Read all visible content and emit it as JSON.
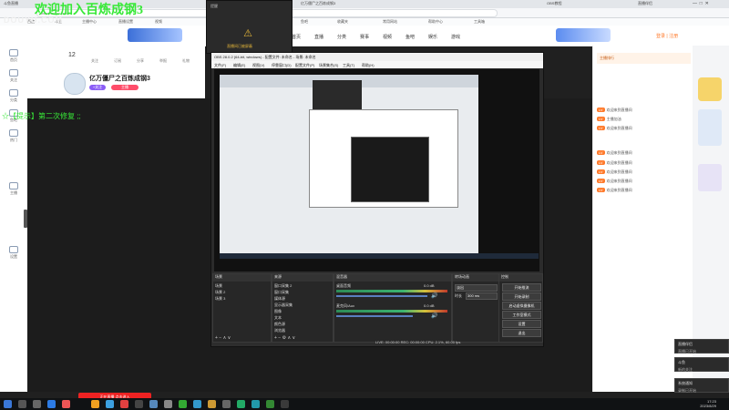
{
  "browser": {
    "tabs": [
      "斗鱼直播",
      "亿万僵尸之百炼成钢3",
      "OBS教程",
      "直播伴侣"
    ],
    "address": "www.douyu.com/...",
    "bookmarks": [
      "百度",
      "斗鱼",
      "主播中心",
      "直播设置",
      "视频",
      "鱼吧",
      "收藏夹",
      "常用网站",
      "帮助中心",
      "工具箱"
    ]
  },
  "watermark": "DOUYU.COM",
  "overlay_title": "欢迎加入百炼成钢3",
  "overlay_sub": "☆【提示】第二次修复 ;;",
  "site": {
    "nav": [
      "首页",
      "直播",
      "分类",
      "赛事",
      "视频",
      "鱼吧",
      "娱乐",
      "游戏"
    ],
    "login": "登录 | 注册"
  },
  "sidebar": [
    "首页",
    "关注",
    "分类",
    "鱼吧",
    "热门",
    "主播",
    "设置"
  ],
  "room": {
    "count": "12",
    "stats": [
      "关注",
      "订阅",
      "分享",
      "举报",
      "礼物"
    ],
    "title": "亿万僵尸之百炼成钢3",
    "follow": "+关注",
    "tag": "主播"
  },
  "chat": {
    "header": "主播排行",
    "messages": [
      {
        "badge": "LV",
        "text": "欢迎来到直播间"
      },
      {
        "badge": "LV",
        "text": "主播加油"
      },
      {
        "badge": "LV",
        "text": "欢迎来到直播间"
      },
      {
        "badge": "LV",
        "text": "欢迎来到直播间"
      },
      {
        "badge": "LV",
        "text": "欢迎来到直播间"
      },
      {
        "badge": "LV",
        "text": "欢迎来到直播间"
      },
      {
        "badge": "LV",
        "text": "欢迎来到直播间"
      },
      {
        "badge": "LV",
        "text": "欢迎来到直播间"
      }
    ]
  },
  "popup": {
    "title": "提醒",
    "warning": "直播间已被屏蔽"
  },
  "obs": {
    "title": "OBS 28.0.2 (64-bit, windows) - 配置文件: 未命名 - 场景: 未命名",
    "menu": [
      "文件(F)",
      "编辑(E)",
      "视图(V)",
      "停靠窗口(D)",
      "配置文件(P)",
      "场景集合(S)",
      "工具(T)",
      "帮助(H)"
    ],
    "panels": {
      "scenes": {
        "title": "场景",
        "items": [
          "场景",
          "场景 2",
          "场景 3"
        ]
      },
      "sources": {
        "title": "来源",
        "items": [
          "窗口采集 2",
          "窗口采集",
          "媒体源",
          "显示器采集",
          "图像",
          "文本",
          "颜色源",
          "浏览器"
        ]
      },
      "mixer": {
        "title": "混音器",
        "tracks": [
          "桌面音频",
          "麦克风/Aux"
        ],
        "values": [
          "0.0 dB",
          "0.0 dB"
        ]
      },
      "transitions": {
        "title": "转场动画",
        "type": "淡出",
        "duration_label": "时长",
        "duration": "300 ms"
      },
      "controls": {
        "title": "控制",
        "buttons": [
          "开始推流",
          "开始录制",
          "启动虚拟摄像机",
          "工作室模式",
          "设置",
          "退出"
        ]
      }
    },
    "status": "LIVE: 00:00:00   REC: 00:00:00   CPU: 2.1%, 60.00 fps"
  },
  "toasts": [
    {
      "title": "直播伴侣",
      "body": "直播已开始"
    },
    {
      "title": "斗鱼",
      "body": "新的关注"
    },
    {
      "title": "系统通知",
      "body": "录制已开始"
    }
  ],
  "promo": "正在直播 点击进入",
  "clock": {
    "time": "17:23",
    "date": "2023/8/29"
  }
}
